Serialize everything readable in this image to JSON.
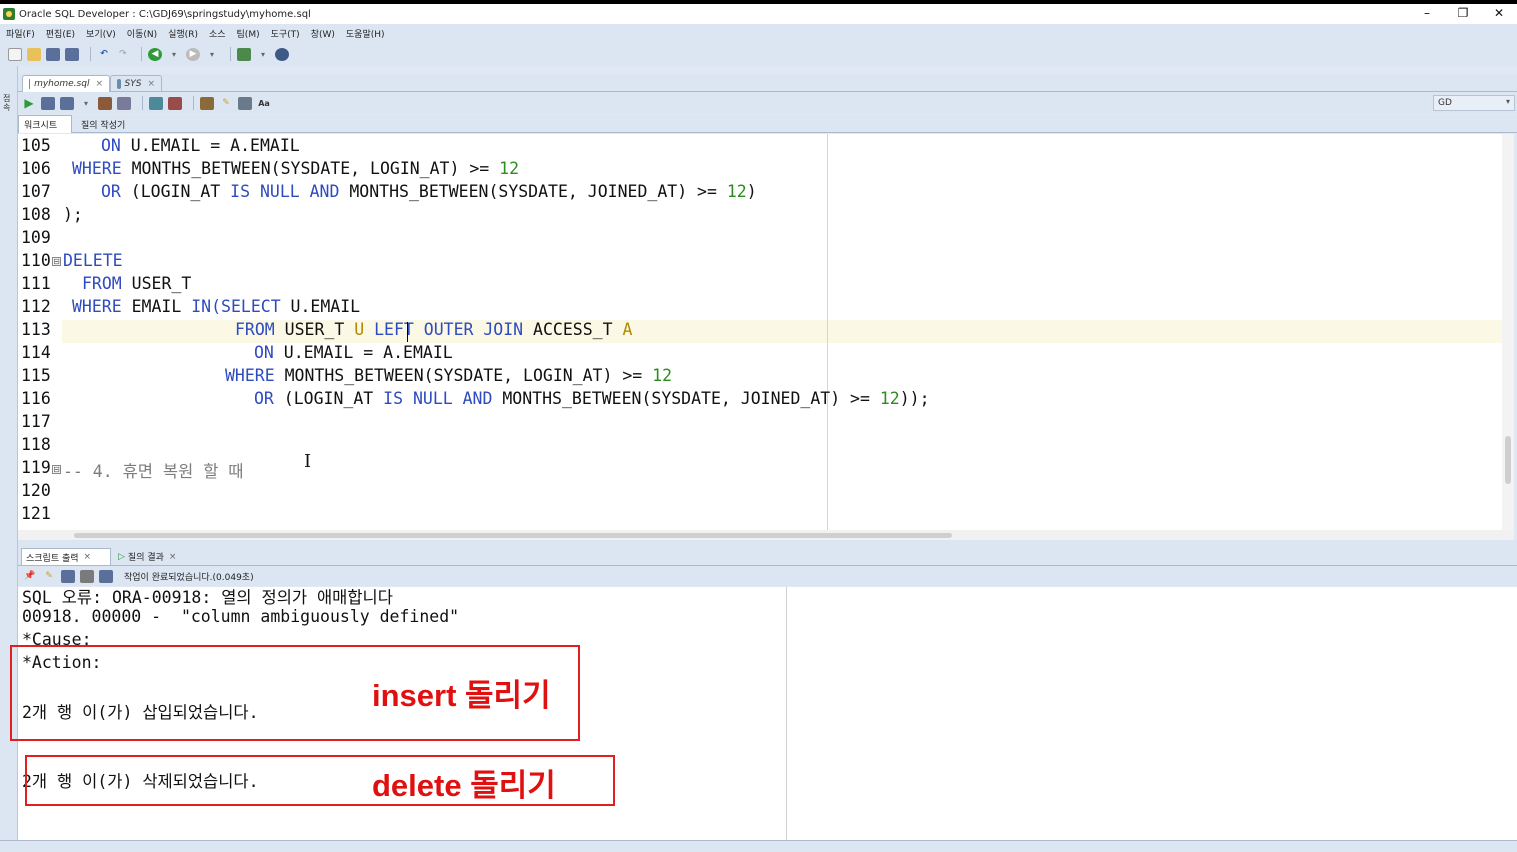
{
  "window": {
    "title": "Oracle SQL Developer : C:\\GDJ69\\springstudy\\myhome.sql",
    "minimize": "–",
    "restore": "❐",
    "close": "✕"
  },
  "menu": [
    "파일(F)",
    "편집(E)",
    "보기(V)",
    "이동(N)",
    "실행(R)",
    "소스",
    "팀(M)",
    "도구(T)",
    "창(W)",
    "도움말(H)"
  ],
  "tabs": [
    {
      "label": "myhome.sql",
      "close": "×"
    },
    {
      "label": "SYS",
      "close": "×"
    }
  ],
  "connection": {
    "label": "GD",
    "dropdown": "▾"
  },
  "subtabs": {
    "worksheet": "워크시트",
    "query_builder": "질의 작성기"
  },
  "sidebar_label": "접속",
  "editor": {
    "line_numbers": [
      "105",
      "106",
      "107",
      "108",
      "109",
      "110",
      "111",
      "112",
      "113",
      "114",
      "115",
      "116",
      "117",
      "118",
      "119",
      "120",
      "121"
    ],
    "l105": {
      "kw1": "ON",
      "t1": " U.EMAIL = A.EMAIL"
    },
    "l106": {
      "kw1": "WHERE",
      "t1": " MONTHS_BETWEEN(SYSDATE, LOGIN_AT) >= ",
      "n1": "12"
    },
    "l107": {
      "kw1": "OR",
      "t1": " (LOGIN_AT ",
      "kw2": "IS NULL AND",
      "t2": " MONTHS_BETWEEN(SYSDATE, JOINED_AT) >= ",
      "n1": "12",
      "t3": ")"
    },
    "l108": {
      "t1": ");"
    },
    "l110": {
      "kw1": "DELETE"
    },
    "l111": {
      "kw1": "FROM",
      "t1": " USER_T"
    },
    "l112": {
      "kw1": "WHERE",
      "t1": " EMAIL ",
      "kw2": "IN(SELECT",
      "t2": " U.EMAIL"
    },
    "l113": {
      "kw1": "FROM",
      "t1": " USER_T ",
      "a1": "U",
      "kw2": " LEFT OUTER JOIN",
      "t2": " ACCESS_T ",
      "a2": "A"
    },
    "l114": {
      "kw1": "ON",
      "t1": " U.EMAIL = A.EMAIL"
    },
    "l115": {
      "kw1": "WHERE",
      "t1": " MONTHS_BETWEEN(SYSDATE, LOGIN_AT) >= ",
      "n1": "12"
    },
    "l116": {
      "kw1": "OR",
      "t1": " (LOGIN_AT ",
      "kw2": "IS NULL AND",
      "t2": " MONTHS_BETWEEN(SYSDATE, JOINED_AT) >= ",
      "n1": "12",
      "t3": "));"
    },
    "l119": {
      "c1": "-- 4. 휴면 복원 할 때"
    },
    "fold_mark": "⊟"
  },
  "output_tabs": {
    "script_output": "스크립트 출력",
    "query_result": "질의 결과",
    "close": "×"
  },
  "output_status": "작업이 완료되었습니다.(0.049초)",
  "output": {
    "l1": "SQL 오류: ORA-00918: 열의 정의가 애매합니다",
    "l2": "00918. 00000 -  \"column ambiguously defined\"",
    "l3": "*Cause:",
    "l4": "*Action:",
    "l5": "2개 행 이(가) 삽입되었습니다.",
    "l6": "2개 행 이(가) 삭제되었습니다."
  },
  "annotations": {
    "insert": "insert 돌리기",
    "delete": "delete 돌리기"
  },
  "colors": {
    "keyword": "#2e4bbf",
    "number": "#2e8b1f",
    "annotation_red": "#e01010",
    "chrome": "#dce6f2"
  }
}
